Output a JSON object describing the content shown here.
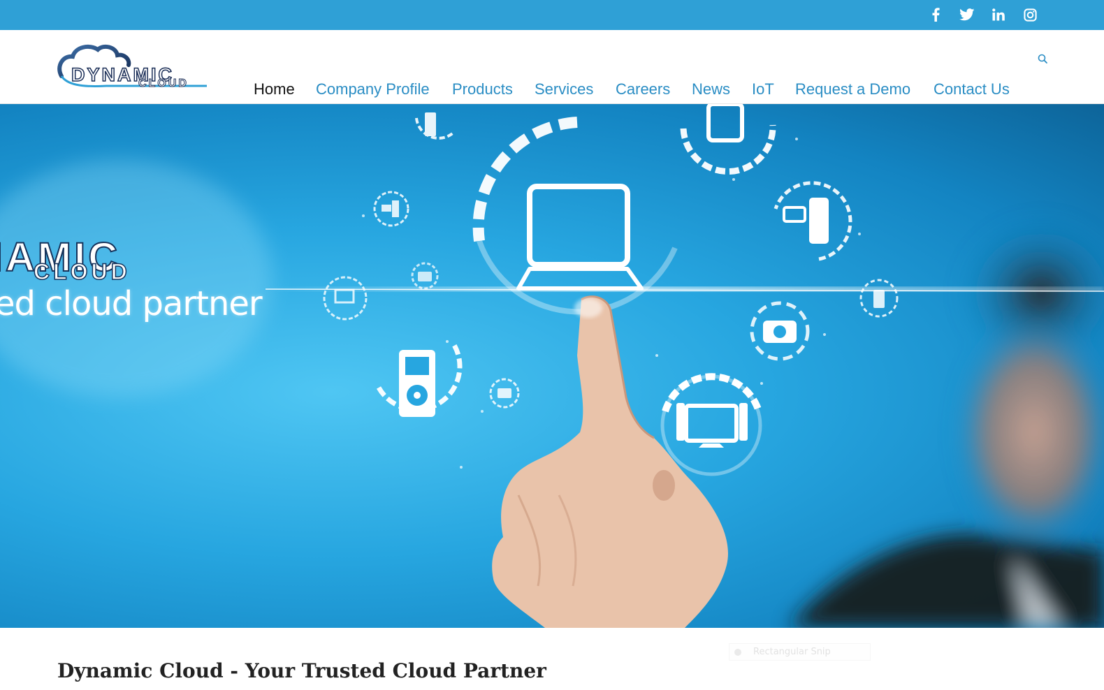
{
  "social": {
    "items": [
      {
        "name": "facebook-icon",
        "glyph": "f"
      },
      {
        "name": "twitter-icon",
        "glyph": "twitter-bird"
      },
      {
        "name": "linkedin-icon",
        "glyph": "in"
      },
      {
        "name": "instagram-icon",
        "glyph": "instagram-camera"
      }
    ]
  },
  "logo": {
    "word": "DYNAMIC",
    "sub": "CLOUD"
  },
  "nav": {
    "items": [
      {
        "label": "Home",
        "active": true
      },
      {
        "label": "Company Profile"
      },
      {
        "label": "Products"
      },
      {
        "label": "Services"
      },
      {
        "label": "Careers"
      },
      {
        "label": "News"
      },
      {
        "label": "IoT"
      },
      {
        "label": "Request a Demo"
      },
      {
        "label": "Contact Us"
      }
    ],
    "search_icon": "search-icon"
  },
  "hero": {
    "brand": "NAMIC",
    "brand_sub": "CLOUD",
    "tagline": "ed cloud partner"
  },
  "page": {
    "title": "Dynamic Cloud - Your Trusted Cloud Partner"
  },
  "overlay": {
    "snip_label": "Rectangular Snip"
  },
  "colors": {
    "accent": "#2fa0d6",
    "nav_link": "#2a8dc4",
    "logo_navy": "#1b2e57"
  }
}
